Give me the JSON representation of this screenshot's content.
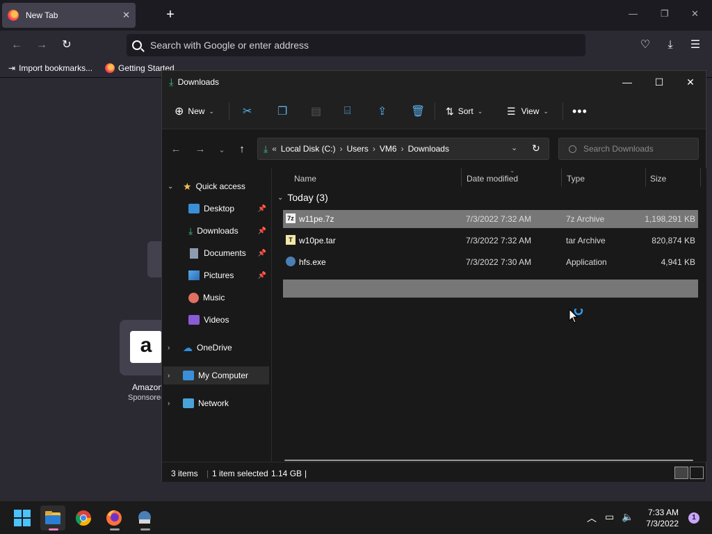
{
  "browser": {
    "tab_title": "New Tab",
    "url_placeholder": "Search with Google or enter address",
    "bookmarks": [
      "Import bookmarks...",
      "Getting Started"
    ],
    "topsite_label": "Amazon",
    "topsite_sub": "Sponsored"
  },
  "explorer": {
    "title": "Downloads",
    "toolbar": {
      "new_label": "New",
      "sort_label": "Sort",
      "view_label": "View"
    },
    "breadcrumb": [
      "Local Disk (C:)",
      "Users",
      "VM6",
      "Downloads"
    ],
    "search_placeholder": "Search Downloads",
    "nav": {
      "quick_access": "Quick access",
      "items": [
        {
          "label": "Desktop",
          "pinned": true
        },
        {
          "label": "Downloads",
          "pinned": true
        },
        {
          "label": "Documents",
          "pinned": true
        },
        {
          "label": "Pictures",
          "pinned": true
        },
        {
          "label": "Music",
          "pinned": false
        },
        {
          "label": "Videos",
          "pinned": false
        }
      ],
      "onedrive": "OneDrive",
      "my_computer": "My Computer",
      "network": "Network"
    },
    "columns": [
      "Name",
      "Date modified",
      "Type",
      "Size"
    ],
    "group_label": "Today (3)",
    "files": [
      {
        "name": "w11pe.7z",
        "date": "7/3/2022 7:32 AM",
        "type": "7z Archive",
        "size": "1,198,291 KB"
      },
      {
        "name": "w10pe.tar",
        "date": "7/3/2022 7:32 AM",
        "type": "tar Archive",
        "size": "820,874 KB"
      },
      {
        "name": "hfs.exe",
        "date": "7/3/2022 7:30 AM",
        "type": "Application",
        "size": "4,941 KB"
      }
    ],
    "status": {
      "items": "3 items",
      "selected": "1 item selected",
      "size": "1.14 GB"
    }
  },
  "taskbar": {
    "time": "7:33 AM",
    "date": "7/3/2022",
    "notifications": "1"
  }
}
